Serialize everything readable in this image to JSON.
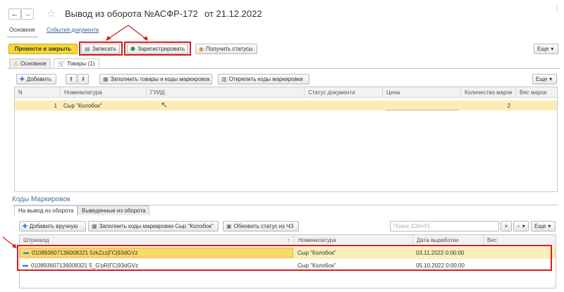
{
  "window": {
    "title": "Вывод из оборота №АСФР-172",
    "date": "от 21.12.2022",
    "nav_tabs": [
      "Основное",
      "События документа"
    ]
  },
  "toolbar": {
    "post_close": "Провести и закрыть",
    "save": "Записать",
    "register": "Зарегистрировать",
    "get_statuses": "Получить статусы",
    "more": "Еще"
  },
  "doc_tabs": [
    "Основное",
    "Товары (1)"
  ],
  "goods": {
    "add": "Добавить",
    "fill_codes": "Заполнить товары и коды маркировок",
    "detach_codes": "Открепить коды маркировки",
    "more": "Еще",
    "columns": [
      "N",
      "Номенклатура",
      "ГУИД",
      "Статус документа",
      "Цена",
      "Количество марок",
      "Вес марок"
    ],
    "rows": [
      {
        "n": "1",
        "nomenclature": "Сыр \"Колобок\"",
        "guid": "",
        "status": "",
        "price": "",
        "qty": "2",
        "weight": ""
      }
    ]
  },
  "codes": {
    "section_title": "Коды Маркировок",
    "tabs": [
      "На вывод из оборота",
      "Выведенные из оборота"
    ],
    "add_manual": "Добавить вручную",
    "fill_codes": "Заполнить коды маркировки Сыр \"Колобок\"",
    "update_status": "Обновить статус из ЧЗ",
    "search_placeholder": "Поиск (Ctrl+F)",
    "more": "Еще",
    "columns": [
      "Штрихкод",
      "Номенклатура",
      "Дата выработки",
      "Вес"
    ],
    "rows": [
      {
        "barcode": "010893607136008321 5zkZzz|ГС|93dGVz",
        "nomenclature": "Сыр \"Колобок\"",
        "date": "03.11.2022 0:00:00",
        "weight": ""
      },
      {
        "barcode": "010893607136008321 5_G'pR|ГС|93dGVz",
        "nomenclature": "Сыр \"Колобок\"",
        "date": "05.10.2022 0:00:00",
        "weight": ""
      }
    ]
  },
  "colors": {
    "accent_yellow": "#f7d638",
    "selected_row": "#fbedb8",
    "annotation_red": "#d81e1e"
  }
}
